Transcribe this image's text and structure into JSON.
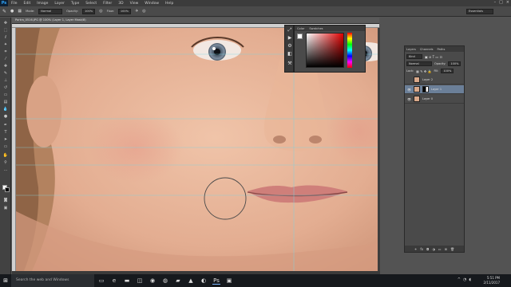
{
  "app": {
    "logo": "Ps"
  },
  "menubar": {
    "items": [
      "File",
      "Edit",
      "Image",
      "Layer",
      "Type",
      "Select",
      "Filter",
      "3D",
      "View",
      "Window",
      "Help"
    ]
  },
  "options_bar": {
    "mode_label": "Mode:",
    "mode_value": "Normal",
    "opacity_label": "Opacity:",
    "opacity_value": "100%",
    "flow_label": "Flow:",
    "flow_value": "100%",
    "workspace": "Essentials"
  },
  "document": {
    "tab_title": "Portra_0516.JPG @ 100% (Layer 1, Layer Mask/8)"
  },
  "color_panel": {
    "tabs": [
      "Color",
      "Swatches"
    ],
    "foreground": "#ffffff"
  },
  "layers_panel": {
    "tabs": [
      "Layers",
      "Channels",
      "Paths"
    ],
    "kind_label": "Kind",
    "blend_mode": "Normal",
    "opacity_label": "Opacity:",
    "opacity_value": "100%",
    "lock_label": "Lock:",
    "fill_label": "Fill:",
    "fill_value": "100%",
    "layers": [
      {
        "name": "Layer 2",
        "selected": false,
        "has_mask": false
      },
      {
        "name": "Layer 1",
        "selected": true,
        "has_mask": true
      },
      {
        "name": "Layer 0",
        "selected": false,
        "has_mask": false
      }
    ]
  },
  "taskbar": {
    "search_placeholder": "Search the web and Windows",
    "time": "5:51 PM",
    "date": "2/11/2017"
  }
}
